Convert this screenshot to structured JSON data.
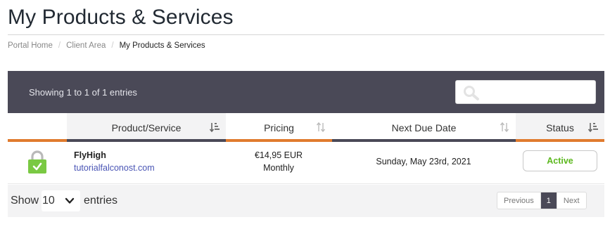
{
  "page": {
    "title": "My Products & Services"
  },
  "breadcrumb": [
    {
      "label": "Portal Home"
    },
    {
      "label": "Client Area"
    },
    {
      "label": "My Products & Services"
    }
  ],
  "table": {
    "info": "Showing 1 to 1 of 1 entries",
    "search_placeholder": "",
    "columns": [
      {
        "label": "Product/Service",
        "sort": "active-desc"
      },
      {
        "label": "Pricing",
        "sort": "none"
      },
      {
        "label": "Next Due Date",
        "sort": "none"
      },
      {
        "label": "Status",
        "sort": "active"
      }
    ],
    "rows": [
      {
        "icon": "lock-icon",
        "name": "FlyHigh",
        "domain": "tutorialfalconost.com",
        "price": "€14,95 EUR",
        "cycle": "Monthly",
        "due": "Sunday, May 23rd, 2021",
        "status": "Active"
      }
    ]
  },
  "footer": {
    "show_label": "Show",
    "page_length": "10",
    "entries_label": "entries",
    "pagination": {
      "previous": "Previous",
      "current": "1",
      "next": "Next"
    }
  },
  "colors": {
    "toolbar_bg": "#4a4957",
    "accent_orange": "#e07b2e",
    "status_green": "#5cb81e",
    "link_blue": "#4a55b5",
    "icon_green": "#7ac943"
  }
}
